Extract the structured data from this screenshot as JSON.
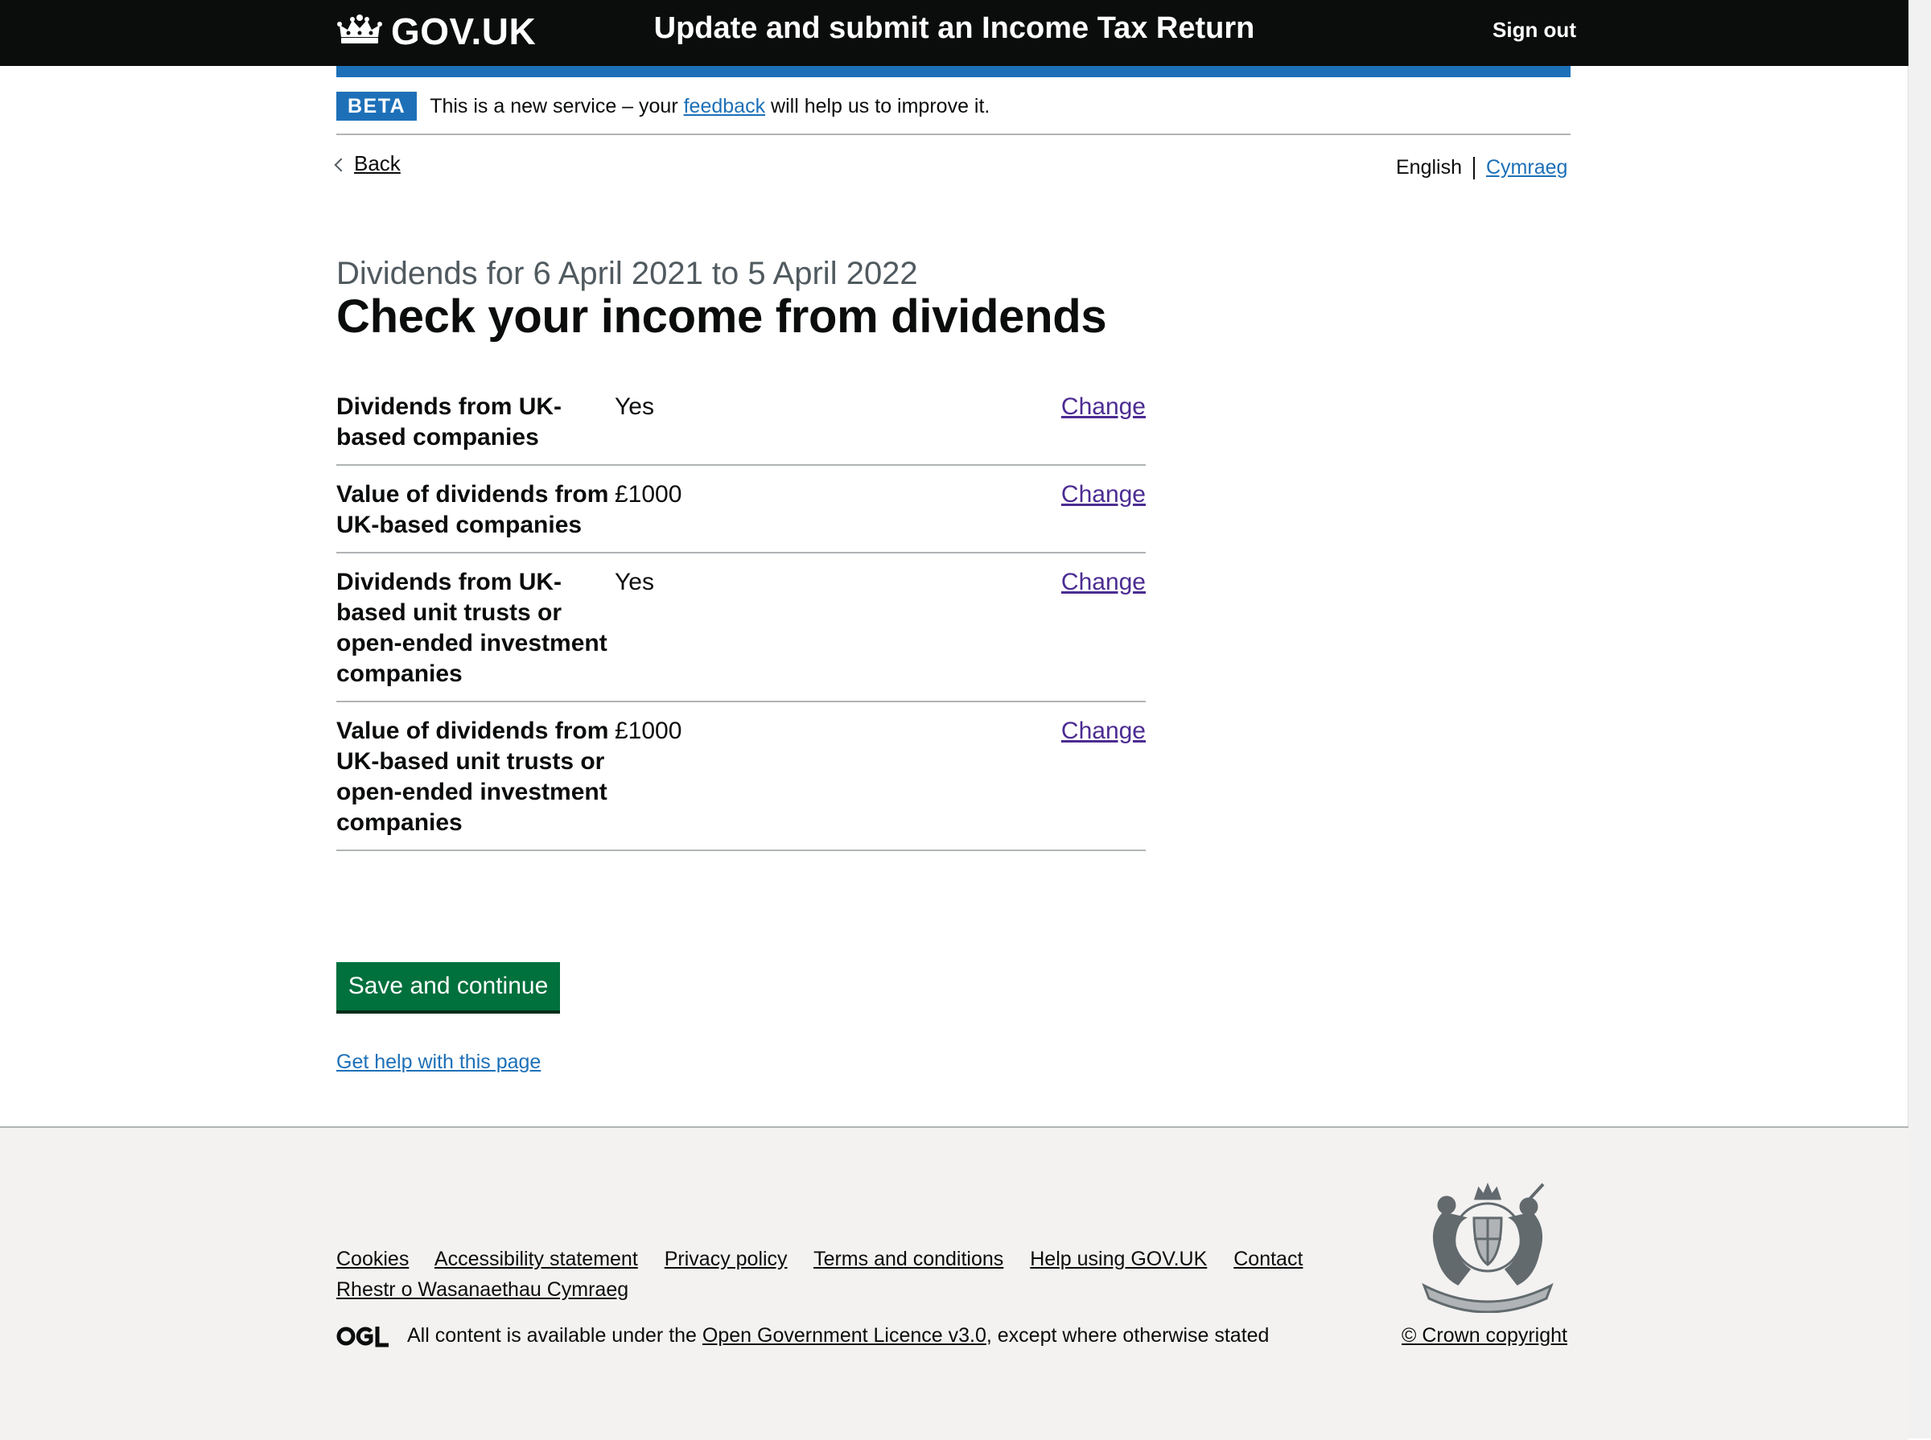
{
  "header": {
    "logo_text": "GOV.UK",
    "service_name": "Update and submit an Income Tax Return",
    "sign_out": "Sign out"
  },
  "phase_banner": {
    "tag": "BETA",
    "text_before": "This is a new service – your",
    "link": "feedback",
    "text_after": "will help us to improve it."
  },
  "nav": {
    "back": "Back",
    "lang_english": "English",
    "lang_welsh": "Cymraeg"
  },
  "page": {
    "caption": "Dividends for 6 April 2021 to 5 April 2022",
    "title": "Check your income from dividends"
  },
  "summary": [
    {
      "key": "Dividends from UK-based companies",
      "value": "Yes",
      "action": "Change"
    },
    {
      "key": "Value of dividends from UK-based companies",
      "value": "£1000",
      "action": "Change"
    },
    {
      "key": "Dividends from UK-based unit trusts or open-ended investment companies",
      "value": "Yes",
      "action": "Change"
    },
    {
      "key": "Value of dividends from UK-based unit trusts or open-ended investment companies",
      "value": "£1000",
      "action": "Change"
    }
  ],
  "actions": {
    "save": "Save and continue",
    "help": "Get help with this page"
  },
  "footer": {
    "links": [
      "Cookies",
      "Accessibility statement",
      "Privacy policy",
      "Terms and conditions",
      "Help using GOV.UK",
      "Contact",
      "Rhestr o Wasanaethau Cymraeg"
    ],
    "licence_before": "All content is available under the",
    "licence_link": "Open Government Licence v3.0",
    "licence_after": ", except where otherwise stated",
    "copyright": "© Crown copyright"
  },
  "colors": {
    "header_bg": "#0b0c0c",
    "brand_blue": "#1d70b8",
    "button_green": "#00703c",
    "visited_link": "#4c2c92",
    "footer_bg": "#f3f2f1"
  },
  "icons": [
    "crown-icon",
    "chevron-left-icon",
    "ogl-logo-icon",
    "royal-coat-of-arms-icon"
  ]
}
